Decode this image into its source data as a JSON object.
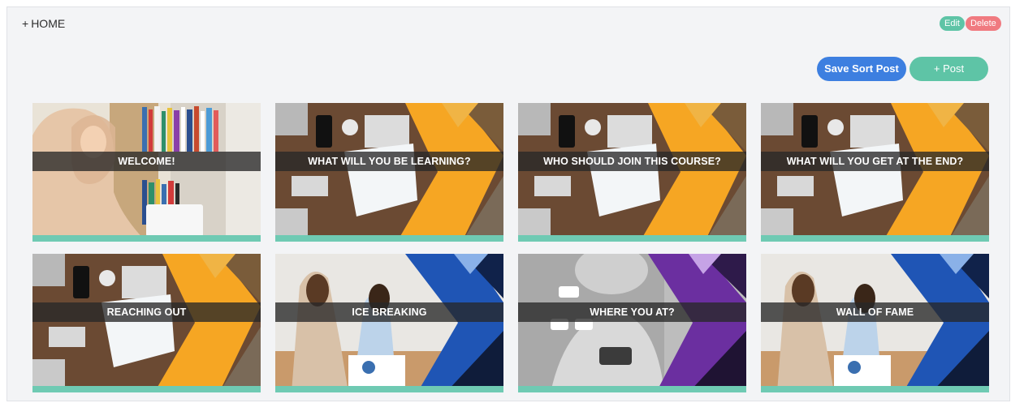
{
  "section": {
    "plus": "+",
    "title": "HOME",
    "edit_label": "Edit",
    "delete_label": "Delete"
  },
  "actions": {
    "save_sort_label": "Save Sort Post",
    "add_post_label": "+ Post"
  },
  "colors": {
    "accent_teal": "#5ec4a6",
    "accent_blue": "#3d7fe0",
    "danger": "#f07a80"
  },
  "posts": [
    {
      "title": "WELCOME!",
      "image": "woman-in-library"
    },
    {
      "title": "WHAT WILL YOU BE LEARNING?",
      "image": "desk-orange-chevron"
    },
    {
      "title": "WHO SHOULD JOIN THIS COURSE?",
      "image": "desk-orange-chevron"
    },
    {
      "title": "WHAT WILL YOU GET AT THE END?",
      "image": "desk-orange-chevron"
    },
    {
      "title": "REACHING OUT",
      "image": "desk-orange-chevron"
    },
    {
      "title": "ICE BREAKING",
      "image": "two-women-blue-chevron"
    },
    {
      "title": "WHERE YOU AT?",
      "image": "woman-phone-purple-chevron"
    },
    {
      "title": "WALL OF FAME",
      "image": "two-women-blue-chevron"
    }
  ]
}
